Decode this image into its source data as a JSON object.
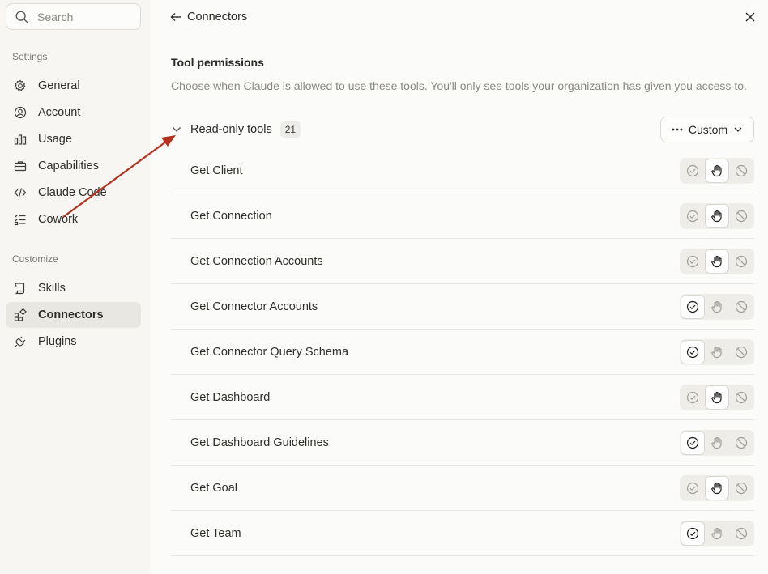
{
  "sidebar": {
    "search_placeholder": "Search",
    "settings_label": "Settings",
    "settings_items": [
      {
        "label": "General",
        "icon": "gear-icon"
      },
      {
        "label": "Account",
        "icon": "user-circle-icon"
      },
      {
        "label": "Usage",
        "icon": "bar-chart-icon"
      },
      {
        "label": "Capabilities",
        "icon": "briefcase-icon"
      },
      {
        "label": "Claude Code",
        "icon": "code-icon"
      },
      {
        "label": "Cowork",
        "icon": "checklist-icon"
      }
    ],
    "customize_label": "Customize",
    "customize_items": [
      {
        "label": "Skills",
        "icon": "scroll-icon"
      },
      {
        "label": "Connectors",
        "icon": "connectors-icon",
        "active": true
      },
      {
        "label": "Plugins",
        "icon": "plug-icon"
      }
    ]
  },
  "header": {
    "title": "Connectors"
  },
  "permissions": {
    "title": "Tool permissions",
    "description": "Choose when Claude is allowed to use these tools. You'll only see tools your organization has given you access to.",
    "group": {
      "title": "Read-only tools",
      "count": "21",
      "mode_label": "Custom"
    },
    "tools": [
      {
        "name": "Get Client",
        "permission": "ask"
      },
      {
        "name": "Get Connection",
        "permission": "ask"
      },
      {
        "name": "Get Connection Accounts",
        "permission": "ask"
      },
      {
        "name": "Get Connector Accounts",
        "permission": "allow"
      },
      {
        "name": "Get Connector Query Schema",
        "permission": "allow"
      },
      {
        "name": "Get Dashboard",
        "permission": "ask"
      },
      {
        "name": "Get Dashboard Guidelines",
        "permission": "allow"
      },
      {
        "name": "Get Goal",
        "permission": "ask"
      },
      {
        "name": "Get Team",
        "permission": "allow"
      }
    ]
  },
  "colors": {
    "annotation_arrow": "#b3311e",
    "active_nav_bg": "#e9e7e2"
  }
}
